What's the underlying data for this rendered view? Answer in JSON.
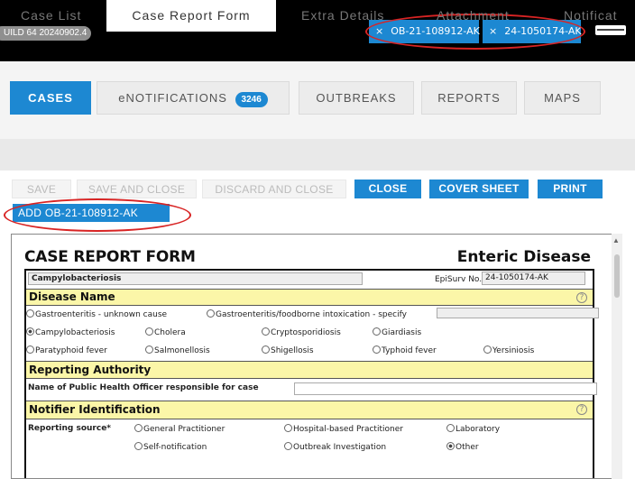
{
  "header": {
    "build": "UILD 64 20240902.4",
    "chips": [
      {
        "close": "×",
        "label": "OB-21-108912-AK"
      },
      {
        "close": "×",
        "label": "24-1050174-AK"
      }
    ]
  },
  "nav": {
    "cases": "CASES",
    "enotifications": "eNOTIFICATIONS",
    "enotifications_count": "3246",
    "outbreaks": "OUTBREAKS",
    "reports": "REPORTS",
    "maps": "MAPS"
  },
  "tabs": [
    "Case List",
    "Case Report Form",
    "Extra Details",
    "Attachment",
    "Notificat"
  ],
  "toolbar": {
    "save": "SAVE",
    "save_close": "SAVE AND CLOSE",
    "discard": "DISCARD AND CLOSE",
    "close": "CLOSE",
    "cover": "COVER SHEET",
    "print": "PRINT",
    "add": "ADD OB-21-108912-AK"
  },
  "form": {
    "title": "CASE REPORT FORM",
    "category": "Enteric Disease",
    "disease_value": "Campylobacteriosis",
    "episurv_label": "EpiSurv No.",
    "episurv_value": "24-1050174-AK",
    "disease_name_heading": "Disease Name",
    "help": "?",
    "diseases_row1": [
      "Gastroenteritis - unknown cause",
      "Gastroenteritis/foodborne intoxication - specify"
    ],
    "diseases_row2": [
      "Campylobacteriosis",
      "Cholera",
      "Cryptosporidiosis",
      "Giardiasis"
    ],
    "diseases_row3": [
      "Paratyphoid fever",
      "Salmonellosis",
      "Shigellosis",
      "Typhoid fever",
      "Yersiniosis"
    ],
    "reporting_heading": "Reporting Authority",
    "pho_label": "Name of Public Health Officer responsible for case",
    "notifier_heading": "Notifier Identification",
    "reporting_source_label": "Reporting source*",
    "sources_row1": [
      "General Practitioner",
      "Hospital-based Practitioner",
      "Laboratory"
    ],
    "sources_row2": [
      "Self-notification",
      "Outbreak Investigation",
      "Other"
    ]
  }
}
